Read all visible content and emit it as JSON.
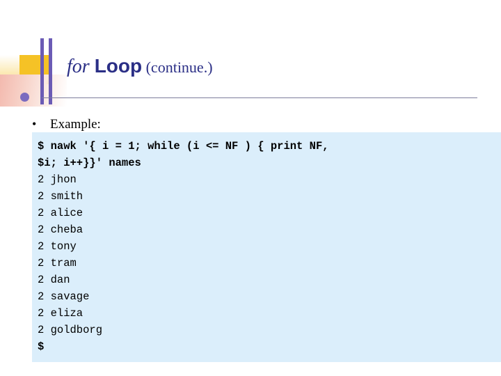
{
  "slide": {
    "title": {
      "italic_part": "for ",
      "bold_part": "Loop",
      "rest_part": " (continue.)"
    },
    "bullet": {
      "marker": "•",
      "text": "Example:"
    },
    "code": {
      "lines": [
        {
          "text": "$ nawk '{ i = 1; while (i <= NF ) { print NF,",
          "bold": true
        },
        {
          "text": "$i; i++}}' names",
          "bold": true
        },
        {
          "text": "2 jhon",
          "bold": false
        },
        {
          "text": "2 smith",
          "bold": false
        },
        {
          "text": "2 alice",
          "bold": false
        },
        {
          "text": "2 cheba",
          "bold": false
        },
        {
          "text": "2 tony",
          "bold": false
        },
        {
          "text": "2 tram",
          "bold": false
        },
        {
          "text": "2 dan",
          "bold": false
        },
        {
          "text": "2 savage",
          "bold": false
        },
        {
          "text": "2 eliza",
          "bold": false
        },
        {
          "text": "2 goldborg",
          "bold": false
        },
        {
          "text": "$",
          "bold": true
        }
      ]
    },
    "colors": {
      "title": "#2b2f86",
      "code_background": "#dbeefb",
      "accent_yellow": "#f5c226",
      "accent_purple": "#6b5bb5",
      "accent_peach": "#f3b9ae"
    }
  }
}
